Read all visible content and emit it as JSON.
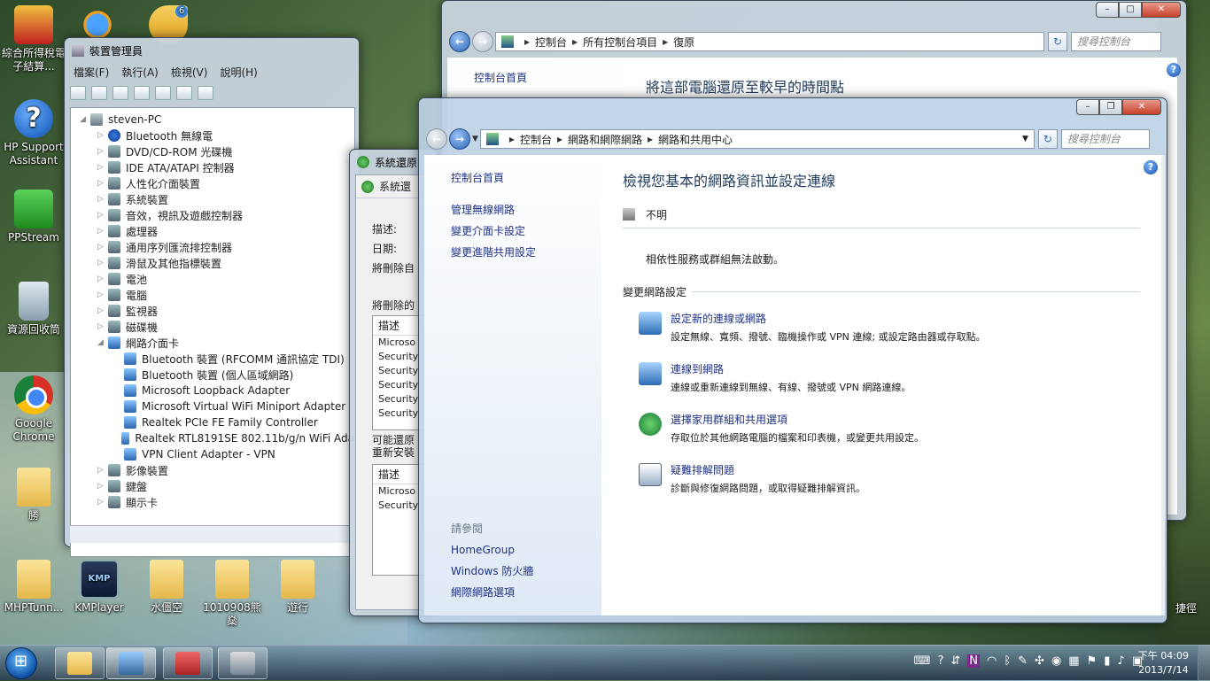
{
  "desktop": {
    "icons": [
      {
        "label": "綜合所得稅電子結算..."
      },
      {
        "label": "HP Support Assistant"
      },
      {
        "label": "PPStream"
      },
      {
        "label": "資源回收筒"
      },
      {
        "label": "Google Chrome"
      },
      {
        "label": "勝"
      },
      {
        "label": "MHPTunn..."
      },
      {
        "label": "KMPlayer"
      },
      {
        "label": "水僵空"
      },
      {
        "label": "1010908熊燊"
      },
      {
        "label": "遊行"
      },
      {
        "label": "捷徑"
      }
    ],
    "badge": "6",
    "kmp_logo": "KMP"
  },
  "device_manager": {
    "title": "裝置管理員",
    "menu": [
      "檔案(F)",
      "執行(A)",
      "檢視(V)",
      "說明(H)"
    ],
    "tree": {
      "root": "steven-PC",
      "items": [
        {
          "label": "Bluetooth 無線電",
          "icon": "bluetooth-icon",
          "level": 1
        },
        {
          "label": "DVD/CD-ROM 光碟機",
          "icon": "disc-icon",
          "level": 1
        },
        {
          "label": "IDE ATA/ATAPI 控制器",
          "icon": "controller-icon",
          "level": 1
        },
        {
          "label": "人性化介面裝置",
          "icon": "hid-icon",
          "level": 1
        },
        {
          "label": "系統裝置",
          "icon": "system-icon",
          "level": 1
        },
        {
          "label": "音效，視訊及遊戲控制器",
          "icon": "speaker-icon",
          "level": 1
        },
        {
          "label": "處理器",
          "icon": "cpu-icon",
          "level": 1
        },
        {
          "label": "通用序列匯流排控制器",
          "icon": "usb-icon",
          "level": 1
        },
        {
          "label": "滑鼠及其他指標裝置",
          "icon": "mouse-icon",
          "level": 1
        },
        {
          "label": "電池",
          "icon": "battery-icon",
          "level": 1
        },
        {
          "label": "電腦",
          "icon": "computer-icon",
          "level": 1
        },
        {
          "label": "監視器",
          "icon": "monitor-icon",
          "level": 1
        },
        {
          "label": "磁碟機",
          "icon": "disk-icon",
          "level": 1
        },
        {
          "label": "網路介面卡",
          "icon": "network-icon",
          "level": 1,
          "expanded": true
        },
        {
          "label": "Bluetooth 裝置 (RFCOMM 通訊協定 TDI)",
          "icon": "network-icon",
          "level": 2
        },
        {
          "label": "Bluetooth 裝置 (個人區域網路)",
          "icon": "network-icon",
          "level": 2
        },
        {
          "label": "Microsoft Loopback Adapter",
          "icon": "network-icon",
          "level": 2
        },
        {
          "label": "Microsoft Virtual WiFi Miniport Adapter",
          "icon": "network-icon",
          "level": 2
        },
        {
          "label": "Realtek PCIe FE Family Controller",
          "icon": "network-icon",
          "level": 2
        },
        {
          "label": "Realtek RTL8191SE 802.11b/g/n WiFi Ada",
          "icon": "network-icon",
          "level": 2
        },
        {
          "label": "VPN Client Adapter - VPN",
          "icon": "network-icon",
          "level": 2
        },
        {
          "label": "影像裝置",
          "icon": "camera-icon",
          "level": 1
        },
        {
          "label": "鍵盤",
          "icon": "keyboard-icon",
          "level": 1
        },
        {
          "label": "顯示卡",
          "icon": "display-icon",
          "level": 1
        }
      ]
    }
  },
  "system_restore": {
    "title": "系統還原",
    "inner_title": "系統還",
    "fields": [
      "描述:",
      "日期:",
      "將刪除自"
    ],
    "section1": "將刪除的",
    "col": "描述",
    "rows1": [
      "Microso",
      "Security",
      "Security",
      "Security",
      "Security",
      "Security"
    ],
    "section2": [
      "可能還原",
      "重新安裝"
    ],
    "rows2": [
      "Microso",
      "Security"
    ]
  },
  "restore_window": {
    "breadcrumb": [
      "控制台",
      "所有控制台項目",
      "復原"
    ],
    "search_placeholder": "搜尋控制台",
    "left_link": "控制台首頁",
    "heading": "將這部電腦還原至較早的時間點"
  },
  "network_window": {
    "breadcrumb": [
      "控制台",
      "網路和網際網路",
      "網路和共用中心"
    ],
    "search_placeholder": "搜尋控制台",
    "left": {
      "home": "控制台首頁",
      "links": [
        "管理無線網路",
        "變更介面卡設定",
        "變更進階共用設定"
      ],
      "see_also_title": "請參閱",
      "see_also": [
        "HomeGroup",
        "Windows 防火牆",
        "網際網路選項"
      ]
    },
    "heading": "檢視您基本的網路資訊並設定連線",
    "network_name": "不明",
    "error_text": "相依性服務或群組無法啟動。",
    "section_title": "變更網路設定",
    "tasks": [
      {
        "title": "設定新的連線或網路",
        "desc": "設定無線、寬頻、撥號、臨機操作或 VPN 連線; 或設定路由器或存取點。"
      },
      {
        "title": "連線到網路",
        "desc": "連線或重新連線到無線、有線、撥號或 VPN 網路連線。"
      },
      {
        "title": "選擇家用群組和共用選項",
        "desc": "存取位於其他網路電腦的檔案和印表機，或變更共用設定。"
      },
      {
        "title": "疑難排解問題",
        "desc": "診斷與修復網路問題，或取得疑難排解資訊。"
      }
    ]
  },
  "taskbar": {
    "time": "下午 04:09",
    "date": "2013/7/14"
  }
}
